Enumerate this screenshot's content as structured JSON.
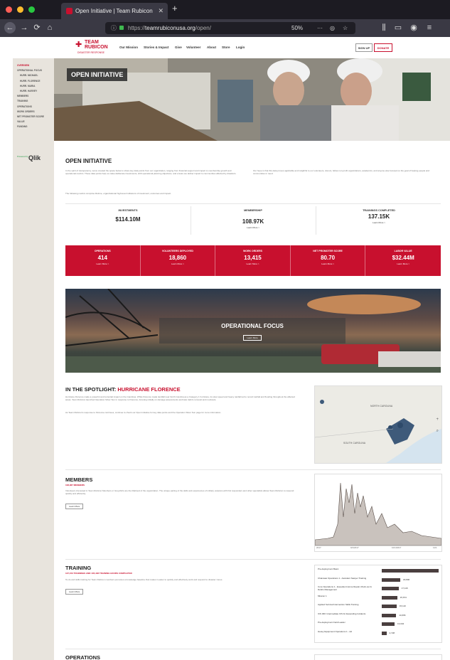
{
  "browser": {
    "tab_title": "Open Initiative | Team Rubicon",
    "new_tab": "+",
    "tab_close": "✕",
    "url_prefix": "https://",
    "url_host": "teamrubiconusa.org",
    "url_path": "/open/",
    "zoom": "50%",
    "dots": [
      "#fe5f57",
      "#febc2e",
      "#28c840"
    ]
  },
  "site": {
    "logo_line1": "TEAM",
    "logo_line2": "RUBICON",
    "logo_line3": "DISASTER RESPONSE",
    "menu": [
      "Our Mission",
      "Stories & Impact",
      "Give",
      "Volunteer",
      "About",
      "Store",
      "Login"
    ],
    "signup": "SIGN UP",
    "donate": "DONATE",
    "accent": "#c8102e"
  },
  "sidebar": {
    "items": [
      {
        "label": "OVERVIEW",
        "sub": false,
        "active": true
      },
      {
        "label": "OPERATIONAL FOCUS",
        "sub": false,
        "active": false
      },
      {
        "label": "HURR. MICHAEL",
        "sub": true,
        "active": false
      },
      {
        "label": "HURR. FLORENCE",
        "sub": true,
        "active": false
      },
      {
        "label": "HURR. MARIA",
        "sub": true,
        "active": false
      },
      {
        "label": "HURR. HARVEY",
        "sub": true,
        "active": false
      },
      {
        "label": "MEMBERS",
        "sub": false,
        "active": false
      },
      {
        "label": "TRAINING",
        "sub": false,
        "active": false
      },
      {
        "label": "OPERATIONS",
        "sub": false,
        "active": false
      },
      {
        "label": "WORK ORDERS",
        "sub": false,
        "active": false
      },
      {
        "label": "NET PROMOTER SCORE",
        "sub": false,
        "active": false
      },
      {
        "label": "VALUE",
        "sub": false,
        "active": false
      },
      {
        "label": "FUNDING",
        "sub": false,
        "active": false
      }
    ],
    "powered_by": "Powered by",
    "qlik": "Qlik"
  },
  "hero": {
    "title": "OPEN INITIATIVE"
  },
  "intro": {
    "heading": "OPEN INITIATIVE",
    "text_left": "In the spirit of transparency, we've created the space below to share key data points from our organization, ranging from financial support and impact to membership growth and operational metrics. These data points help us make deliberate investments, shift operational planning objectives, and ensure we deliver impact to communities affected by disasters.",
    "text_right": "Our hope is that this data proves applicable and insightful to our volunteers, donors, fellow non-profit organizations, academics, and anyone else focused on the goal of helping people and communities in need.",
    "text_below": "The following metrics comprise lifetime, organizational high-level indicators of investment, outcomes and impact."
  },
  "stats": [
    {
      "label": "INVESTMENTS",
      "value": "$114.10M",
      "link": ""
    },
    {
      "label": "MEMBERSHIP",
      "value": "108.97K",
      "link": "Learn More >"
    },
    {
      "label": "TRAININGS COMPLETED",
      "value": "137.15K",
      "link": "Learn More >"
    }
  ],
  "red_stats": [
    {
      "label": "OPERATIONS",
      "value": "414",
      "link": "Learn More >"
    },
    {
      "label": "VOLUNTEERS DEPLOYED",
      "value": "18,860",
      "link": "Learn More >"
    },
    {
      "label": "WORK ORDERS",
      "value": "13,415",
      "link": "Learn More >"
    },
    {
      "label": "NET PROMOTER SCORE",
      "value": "80.70",
      "link": "Learn More >"
    },
    {
      "label": "LABOR VALUE",
      "value": "$32.44M",
      "link": "Learn More >"
    }
  ],
  "op_focus": {
    "title": "OPERATIONAL FOCUS",
    "button": "Learn More"
  },
  "spotlight": {
    "heading_a": "IN THE SPOTLIGHT: ",
    "heading_b": "HURRICANE FLORENCE",
    "text": "Hurricane Florence made a powerful and torrential impact on the Carolinas. While Florence made landfall near North Carolina as a Category 1 hurricane, its slow speed and heavy rainfall led to record rainfall and flooding throughout the affected areas. Team Rubicon launched Operation Silver Sun in response to Florence, focusing initially on damage assessments and later debris removal and muckouts.",
    "text2": "As Team Rubicon's response to Florence continues, continue to check our Open Initiative for key data points and the Operation Silver Sun page for more information.",
    "map_labels": [
      "NORTH CAROLINA",
      "SOUTH CAROLINA"
    ]
  },
  "members": {
    "heading": "MEMBERS",
    "sub": "108,967 MEMBERS",
    "text": "Volunteers interested in Team Rubicon Members or Greyshirts are the lifeblood of the organization. The unique pairing of the skills and experiences of military veterans with first responders and other specialists allows Team Rubicon to respond quickly and efficiently.",
    "button": "Learn More",
    "x_ticks": [
      "2017",
      "9/1/2017",
      "10/1/2017",
      "11/1"
    ]
  },
  "training": {
    "heading": "TRAINING",
    "sub": "137,153 TRAININGS AND 135,448 TRAINING HOURS COMPLETED",
    "text": "To-do and skills training for Team Rubicon members promotes a knowledge baseline that makes it easier to quickly and effectively work and respond to disaster zones.",
    "button": "Learn More",
    "rows": [
      {
        "label": "Pre-deployment Basic",
        "value": null,
        "display": ""
      },
      {
        "label": "Chainsaw Operations 1 - Assistant Sawyer Training",
        "value": 18806,
        "display": "18,806"
      },
      {
        "label": "Core Operations 1 - Expedient Home Repair, Muck-out & Debris Management",
        "value": 17116,
        "display": "17,116"
      },
      {
        "label": "Mission 1",
        "value": 15674,
        "display": "15,674"
      },
      {
        "label": "Applied Survival Intervention Skills Training",
        "value": 15110,
        "display": "15,110"
      },
      {
        "label": "ICS 300: Intermediate ICS for Expanding Incidents",
        "value": 14666,
        "display": "14,666"
      },
      {
        "label": "Pre-deployment Field Leader",
        "value": 13034,
        "display": "13,034"
      },
      {
        "label": "Heavy Equipment Operations 1 - Hit",
        "value": 4728,
        "display": "4,728"
      }
    ]
  },
  "operations": {
    "heading": "OPERATIONS"
  }
}
